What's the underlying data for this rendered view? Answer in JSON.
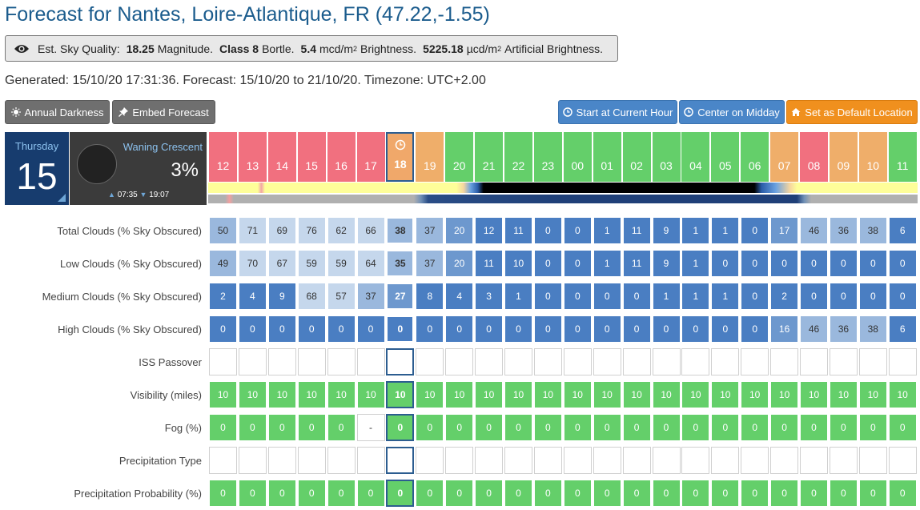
{
  "title": "Forecast for Nantes, Loire-Atlantique, FR (47.22,-1.55)",
  "sky": {
    "icon": "eye-icon",
    "label": "Est. Sky Quality:",
    "magnitude_value": "18.25",
    "magnitude_unit": "Magnitude.",
    "class_label": "Class 8",
    "bortle": "Bortle.",
    "brightness_value": "5.4",
    "brightness_unit_pre": "mcd/m",
    "brightness_unit_sup": "2",
    "brightness_label": "Brightness.",
    "artificial_value": "5225.18",
    "artificial_unit_pre": "µcd/m",
    "artificial_unit_sup": "2",
    "artificial_label": "Artificial Brightness."
  },
  "generated": "Generated: 15/10/20 17:31:36. Forecast: 15/10/20 to 21/10/20. Timezone: UTC+2.00",
  "buttons": {
    "annual_darkness": "Annual Darkness",
    "embed_forecast": "Embed Forecast",
    "start_current_hour": "Start at Current Hour",
    "center_midday": "Center on Midday",
    "set_default": "Set as Default Location"
  },
  "date": {
    "weekday": "Thursday",
    "day": "15"
  },
  "moon": {
    "phase": "Waning Crescent",
    "percent": "3%",
    "rise": "07:35",
    "set": "19:07"
  },
  "hours": [
    "12",
    "13",
    "14",
    "15",
    "16",
    "17",
    "18",
    "19",
    "20",
    "21",
    "22",
    "23",
    "00",
    "01",
    "02",
    "03",
    "04",
    "05",
    "06",
    "07",
    "08",
    "09",
    "10",
    "11"
  ],
  "current_hour_index": 6,
  "colors": {
    "hour_red": "#f1707f",
    "hour_orange": "#efae6a",
    "hour_green": "#64cf6a",
    "hour_current": "#f0a86a",
    "cloud_scale": [
      "#4a7ec2",
      "#6d98ce",
      "#9ab8dd",
      "#c5d7ec"
    ],
    "good": "#64cf6a"
  },
  "hour_colors": [
    "red",
    "red",
    "red",
    "red",
    "red",
    "red",
    "orange",
    "orange",
    "green",
    "green",
    "green",
    "green",
    "green",
    "green",
    "green",
    "green",
    "green",
    "green",
    "green",
    "orange",
    "red",
    "orange",
    "orange",
    "green"
  ],
  "rows": [
    {
      "label": "Total Clouds (% Sky Obscured)",
      "type": "cloud",
      "values": [
        "50",
        "71",
        "69",
        "76",
        "62",
        "66",
        "38",
        "37",
        "20",
        "12",
        "11",
        "0",
        "0",
        "1",
        "11",
        "9",
        "1",
        "1",
        "0",
        "17",
        "46",
        "36",
        "38",
        "6"
      ]
    },
    {
      "label": "Low Clouds (% Sky Obscured)",
      "type": "cloud",
      "values": [
        "49",
        "70",
        "67",
        "59",
        "59",
        "64",
        "35",
        "37",
        "20",
        "11",
        "10",
        "0",
        "0",
        "1",
        "11",
        "9",
        "1",
        "0",
        "0",
        "0",
        "0",
        "0",
        "0",
        "0"
      ]
    },
    {
      "label": "Medium Clouds (% Sky Obscured)",
      "type": "cloud",
      "values": [
        "2",
        "4",
        "9",
        "68",
        "57",
        "37",
        "27",
        "8",
        "4",
        "3",
        "1",
        "0",
        "0",
        "0",
        "0",
        "1",
        "1",
        "1",
        "0",
        "2",
        "0",
        "0",
        "0",
        "0"
      ]
    },
    {
      "label": "High Clouds (% Sky Obscured)",
      "type": "cloud",
      "values": [
        "0",
        "0",
        "0",
        "0",
        "0",
        "0",
        "0",
        "0",
        "0",
        "0",
        "0",
        "0",
        "0",
        "0",
        "0",
        "0",
        "0",
        "0",
        "0",
        "16",
        "46",
        "36",
        "38",
        "6"
      ]
    },
    {
      "label": "ISS Passover",
      "type": "blank",
      "values": [
        "",
        "",
        "",
        "",
        "",
        "",
        "",
        "",
        "",
        "",
        "",
        "",
        "",
        "",
        "",
        "",
        "",
        "",
        "",
        "",
        "",
        "",
        "",
        ""
      ]
    },
    {
      "label": "Visibility (miles)",
      "type": "green",
      "values": [
        "10",
        "10",
        "10",
        "10",
        "10",
        "10",
        "10",
        "10",
        "10",
        "10",
        "10",
        "10",
        "10",
        "10",
        "10",
        "10",
        "10",
        "10",
        "10",
        "10",
        "10",
        "10",
        "10",
        "10"
      ]
    },
    {
      "label": "Fog (%)",
      "type": "green",
      "values": [
        "0",
        "0",
        "0",
        "0",
        "0",
        "-",
        "0",
        "0",
        "0",
        "0",
        "0",
        "0",
        "0",
        "0",
        "0",
        "0",
        "0",
        "0",
        "0",
        "0",
        "0",
        "0",
        "0",
        "0"
      ]
    },
    {
      "label": "Precipitation Type",
      "type": "blank",
      "values": [
        "",
        "",
        "",
        "",
        "",
        "",
        "",
        "",
        "",
        "",
        "",
        "",
        "",
        "",
        "",
        "",
        "",
        "",
        "",
        "",
        "",
        "",
        "",
        ""
      ]
    },
    {
      "label": "Precipitation Probability (%)",
      "type": "green",
      "values": [
        "0",
        "0",
        "0",
        "0",
        "0",
        "0",
        "0",
        "0",
        "0",
        "0",
        "0",
        "0",
        "0",
        "0",
        "0",
        "0",
        "0",
        "0",
        "0",
        "0",
        "0",
        "0",
        "0",
        "0"
      ]
    }
  ]
}
